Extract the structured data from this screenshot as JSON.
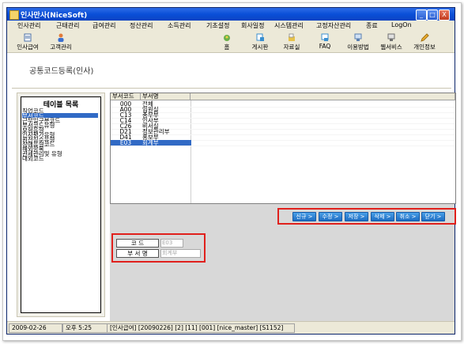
{
  "window": {
    "title": "인사만사(NiceSoft)",
    "min": "_",
    "max": "□",
    "close": "X"
  },
  "menu": [
    "인사관리",
    "근태관리",
    "급여관리",
    "정산관리",
    "소득관리",
    "기초설정",
    "회사일정",
    "시스템관리",
    "고정자산관리",
    "종료",
    "LogOn"
  ],
  "toolbar": {
    "left": [
      {
        "label": "인사급여",
        "icon": "document-icon"
      },
      {
        "label": "고객관리",
        "icon": "person-icon"
      }
    ],
    "right": [
      {
        "label": "홈",
        "icon": "home-icon"
      },
      {
        "label": "게시판",
        "icon": "board-icon"
      },
      {
        "label": "자료실",
        "icon": "folder-icon"
      },
      {
        "label": "FAQ",
        "icon": "faq-icon"
      },
      {
        "label": "이용방법",
        "icon": "help-icon"
      },
      {
        "label": "웹서비스",
        "icon": "web-icon"
      },
      {
        "label": "개인정보",
        "icon": "pencil-icon"
      }
    ]
  },
  "page": {
    "title": "공통코드등록(인사)"
  },
  "table_list": {
    "caption": "테이블 목록",
    "items": [
      "직업코드",
      "부서코드",
      "근무일구분코드",
      "부서코드유형",
      "보험유형",
      "인사평가유형",
      "원천징수유형",
      "장애유형코드",
      "해외항목",
      "관세관리및 유형",
      "대외코드"
    ],
    "selected_index": 1
  },
  "grid": {
    "headers": [
      "부서코드",
      "부서명"
    ],
    "rows": [
      [
        "000",
        "전체"
      ],
      [
        "A00",
        "임원실"
      ],
      [
        "C13",
        "총무부"
      ],
      [
        "C14",
        "인사부"
      ],
      [
        "C26",
        "비서실"
      ],
      [
        "D21",
        "정보관리부"
      ],
      [
        "D41",
        "홍보부"
      ],
      [
        "E03",
        "회계부"
      ]
    ],
    "selected_row": 7
  },
  "actions": [
    "신규 >",
    "수정 >",
    "저장 >",
    "삭제 >",
    "취소 >",
    "닫기 >"
  ],
  "form": {
    "code_label": "코     드",
    "code_value": "E03",
    "name_label": "부 서 명",
    "name_value": "회계부"
  },
  "status": {
    "date": "2009-02-26",
    "time": "오후 5:25",
    "info": "[인사급여] [20090226] [2] [11] [001] [nice_master] [S1152]"
  }
}
